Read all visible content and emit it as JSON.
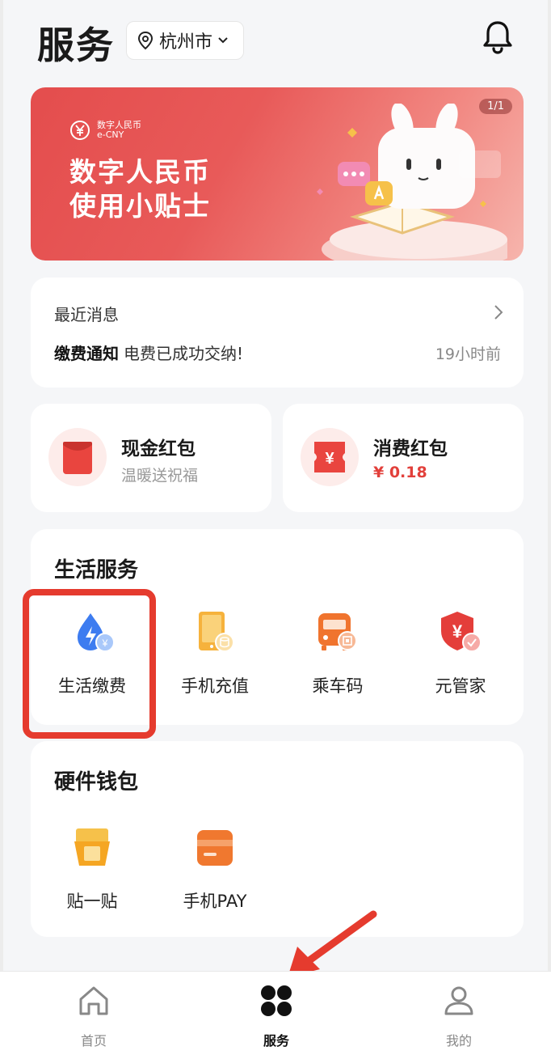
{
  "header": {
    "title": "服务",
    "city": "杭州市"
  },
  "banner": {
    "logo_cn": "数字人民币",
    "logo_en": "e-CNY",
    "title_line1": "数字人民币",
    "title_line2": "使用小贴士",
    "page_indicator": "1/1"
  },
  "messages": {
    "title": "最近消息",
    "item_type": "缴费通知",
    "item_text": "电费已成功交纳!",
    "item_time": "19小时前"
  },
  "packets": [
    {
      "title": "现金红包",
      "subtitle": "温暖送祝福"
    },
    {
      "title": "消费红包",
      "subtitle": "¥ 0.18"
    }
  ],
  "life_services": {
    "title": "生活服务",
    "items": [
      {
        "label": "生活缴费",
        "icon": "water-utility-icon"
      },
      {
        "label": "手机充值",
        "icon": "phone-topup-icon"
      },
      {
        "label": "乘车码",
        "icon": "bus-code-icon"
      },
      {
        "label": "元管家",
        "icon": "yuan-shield-icon"
      }
    ]
  },
  "hardware_wallet": {
    "title": "硬件钱包",
    "items": [
      {
        "label": "贴一贴",
        "icon": "tap-card-icon"
      },
      {
        "label": "手机PAY",
        "icon": "phone-pay-icon"
      }
    ]
  },
  "bottom_nav": {
    "items": [
      {
        "label": "首页",
        "icon": "home-icon"
      },
      {
        "label": "服务",
        "icon": "services-grid-icon"
      },
      {
        "label": "我的",
        "icon": "profile-icon"
      }
    ],
    "active": "服务"
  },
  "colors": {
    "accent_red": "#e2403b",
    "banner_red": "#e44d4d",
    "highlight_border": "#e53b2e",
    "background": "#f5f6f8"
  }
}
